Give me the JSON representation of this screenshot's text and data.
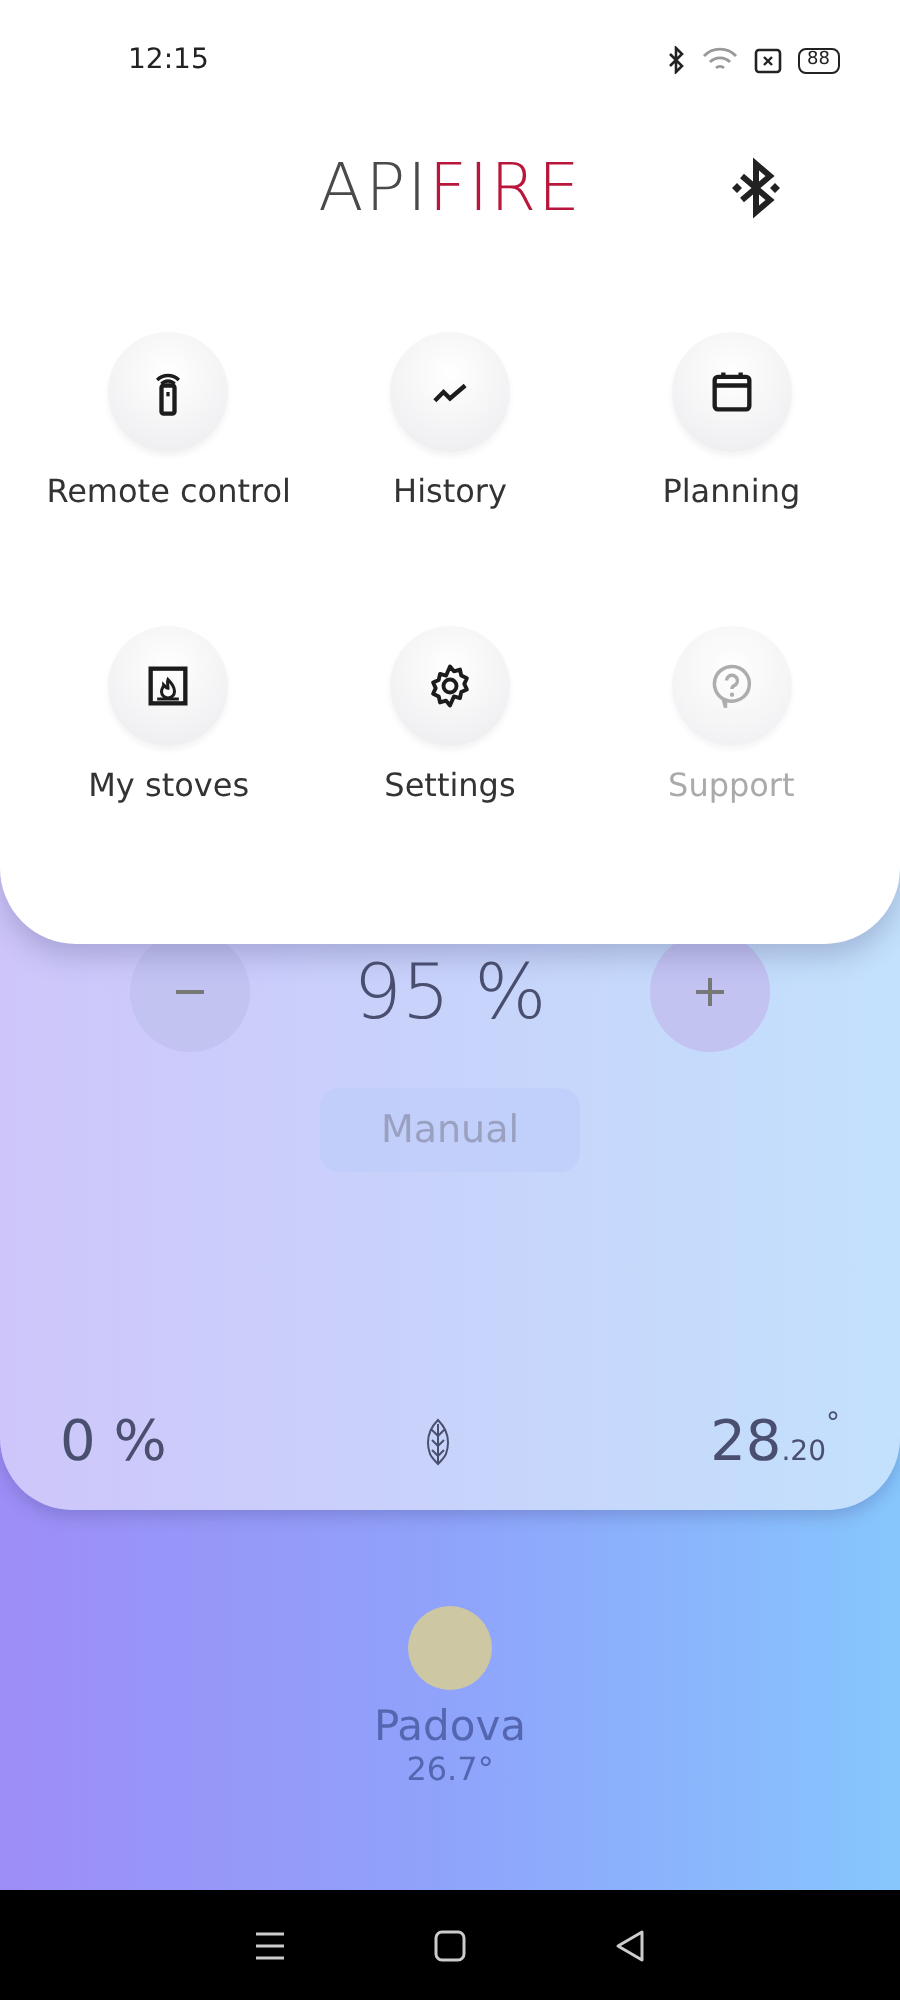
{
  "status_bar": {
    "time": "12:15",
    "battery": "88"
  },
  "logo": {
    "text": "API",
    "accent": "FIRE"
  },
  "menu": [
    {
      "label": "Remote control",
      "kind": "remote",
      "disabled": false
    },
    {
      "label": "History",
      "kind": "history",
      "disabled": false
    },
    {
      "label": "Planning",
      "kind": "planning",
      "disabled": false
    },
    {
      "label": "My stoves",
      "kind": "stoves",
      "disabled": false
    },
    {
      "label": "Settings",
      "kind": "settings",
      "disabled": false
    },
    {
      "label": "Support",
      "kind": "support",
      "disabled": true
    }
  ],
  "stove": {
    "power": "95 %",
    "mode": "Manual",
    "fan": "0 %",
    "temperature": "28$_{.20}$$^{°}$"
  },
  "weather": {
    "city": "Padova",
    "temperature": "26.7°"
  }
}
